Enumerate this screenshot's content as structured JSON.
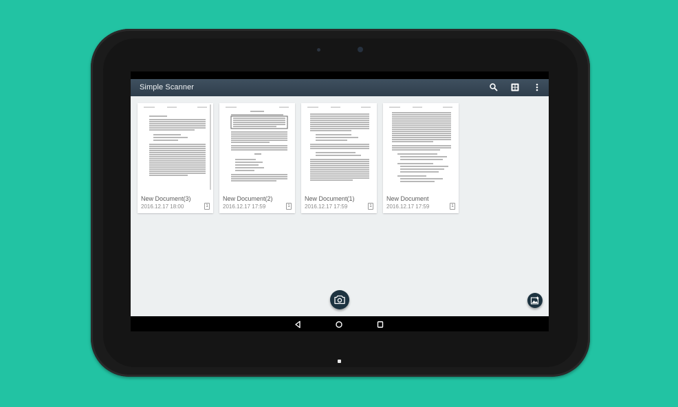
{
  "app": {
    "title": "Simple Scanner"
  },
  "toolbar": {
    "actions": [
      "search-icon",
      "grid-view-icon",
      "more-vert-icon"
    ]
  },
  "documents": [
    {
      "name": "New Document(3)",
      "date": "2016.12.17 18:00",
      "pages": "1"
    },
    {
      "name": "New Document(2)",
      "date": "2016.12.17 17:59",
      "pages": "1"
    },
    {
      "name": "New Document(1)",
      "date": "2016.12.17 17:59",
      "pages": "1"
    },
    {
      "name": "New Document",
      "date": "2016.12.17 17:59",
      "pages": "1"
    }
  ],
  "fabs": {
    "camera": "camera-icon",
    "gallery": "gallery-import-icon"
  },
  "nav": [
    "back-icon",
    "home-icon",
    "recents-icon"
  ],
  "colors": {
    "background": "#22c3a3",
    "appbar": "#34434f",
    "content": "#edf0f1",
    "fab": "#1d3340"
  }
}
